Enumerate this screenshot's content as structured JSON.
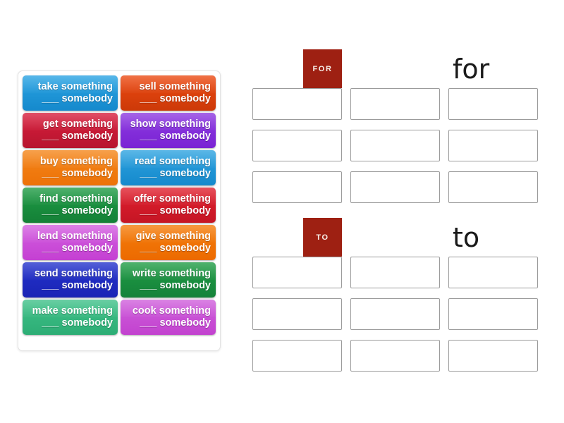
{
  "word_bank": {
    "name": "word-bank",
    "tiles": [
      {
        "line1": "take something",
        "line2": "___ somebody",
        "color": "#29a3e3",
        "color2": "#1589cc"
      },
      {
        "line1": "sell something",
        "line2": "___ somebody",
        "color": "#ec4a12",
        "color2": "#cc3908"
      },
      {
        "line1": "get something",
        "line2": "___ somebody",
        "color": "#d81e3c",
        "color2": "#b7152f"
      },
      {
        "line1": "show something",
        "line2": "___ somebody",
        "color": "#8d3ae0",
        "color2": "#7a23d4"
      },
      {
        "line1": "buy something",
        "line2": "___ somebody",
        "color": "#f4861a",
        "color2": "#ed7208"
      },
      {
        "line1": "read something",
        "line2": "___ somebody",
        "color": "#2ea3e0",
        "color2": "#1589cc"
      },
      {
        "line1": "find something",
        "line2": "___ somebody",
        "color": "#1f9c45",
        "color2": "#148037"
      },
      {
        "line1": "offer something",
        "line2": "___ somebody",
        "color": "#e0212f",
        "color2": "#c51524"
      },
      {
        "line1": "lend something",
        "line2": "___ somebody",
        "color": "#d35fe0",
        "color2": "#c440d2"
      },
      {
        "line1": "give something",
        "line2": "___ somebody",
        "color": "#f47d0c",
        "color2": "#ec6a00"
      },
      {
        "line1": "send something",
        "line2": "___ somebody",
        "color": "#2433cc",
        "color2": "#1a24b5"
      },
      {
        "line1": "write something",
        "line2": "___ somebody",
        "color": "#1f9c45",
        "color2": "#15823a"
      },
      {
        "line1": "make something",
        "line2": "___ somebody",
        "color": "#3fc189",
        "color2": "#2dad75"
      },
      {
        "line1": "cook something",
        "line2": "___ somebody",
        "color": "#cf5fdb",
        "color2": "#c242cf"
      }
    ]
  },
  "groups": [
    {
      "badge": "FOR",
      "title": "for",
      "badge_color": "#9e2012",
      "zones": [
        "",
        "",
        "",
        "",
        "",
        "",
        "",
        "",
        ""
      ]
    },
    {
      "badge": "TO",
      "title": "to",
      "badge_color": "#9e2012",
      "zones": [
        "",
        "",
        "",
        "",
        "",
        "",
        "",
        "",
        ""
      ]
    }
  ]
}
